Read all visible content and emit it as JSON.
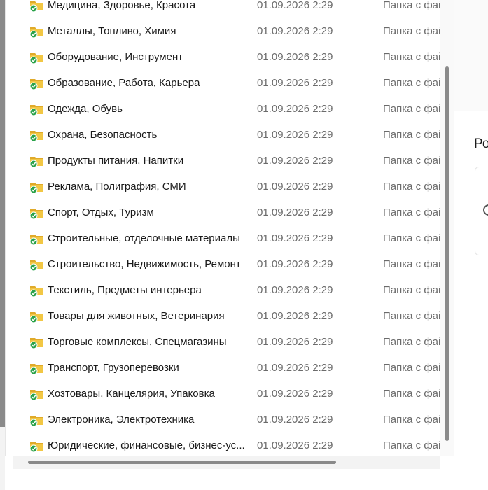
{
  "files": [
    {
      "name": "Медицина, Здоровье, Красота",
      "date": "01.09.2026 2:29",
      "type": "Папка с фай"
    },
    {
      "name": "Металлы, Топливо, Химия",
      "date": "01.09.2026 2:29",
      "type": "Папка с фай"
    },
    {
      "name": "Оборудование, Инструмент",
      "date": "01.09.2026 2:29",
      "type": "Папка с фай"
    },
    {
      "name": "Образование, Работа, Карьера",
      "date": "01.09.2026 2:29",
      "type": "Папка с фай"
    },
    {
      "name": "Одежда, Обувь",
      "date": "01.09.2026 2:29",
      "type": "Папка с фай"
    },
    {
      "name": "Охрана, Безопасность",
      "date": "01.09.2026 2:29",
      "type": "Папка с фай"
    },
    {
      "name": "Продукты питания, Напитки",
      "date": "01.09.2026 2:29",
      "type": "Папка с фай"
    },
    {
      "name": "Реклама, Полиграфия, СМИ",
      "date": "01.09.2026 2:29",
      "type": "Папка с фай"
    },
    {
      "name": "Спорт, Отдых, Туризм",
      "date": "01.09.2026 2:29",
      "type": "Папка с фай"
    },
    {
      "name": "Строительные, отделочные материалы",
      "date": "01.09.2026 2:29",
      "type": "Папка с фай"
    },
    {
      "name": "Строительство, Недвижимость, Ремонт",
      "date": "01.09.2026 2:29",
      "type": "Папка с фай"
    },
    {
      "name": "Текстиль, Предметы интерьера",
      "date": "01.09.2026 2:29",
      "type": "Папка с фай"
    },
    {
      "name": "Товары для животных, Ветеринария",
      "date": "01.09.2026 2:29",
      "type": "Папка с фай"
    },
    {
      "name": "Торговые комплексы, Спецмагазины",
      "date": "01.09.2026 2:29",
      "type": "Папка с фай"
    },
    {
      "name": "Транспорт, Грузоперевозки",
      "date": "01.09.2026 2:29",
      "type": "Папка с фай"
    },
    {
      "name": "Хозтовары, Канцелярия, Упаковка",
      "date": "01.09.2026 2:29",
      "type": "Папка с фай"
    },
    {
      "name": "Электроника, Электротехника",
      "date": "01.09.2026 2:29",
      "type": "Папка с фай"
    },
    {
      "name": "Юридические, финансовые, бизнес-ус...",
      "date": "01.09.2026 2:29",
      "type": "Папка с фай"
    }
  ],
  "right_pane": {
    "heading": "Ро"
  },
  "icons": {
    "folder": "folder-icon",
    "status": "synced-check-icon"
  },
  "colors": {
    "folder": "#f2c744",
    "folder_dark": "#e0aa2a",
    "check": "#2aa24a"
  }
}
